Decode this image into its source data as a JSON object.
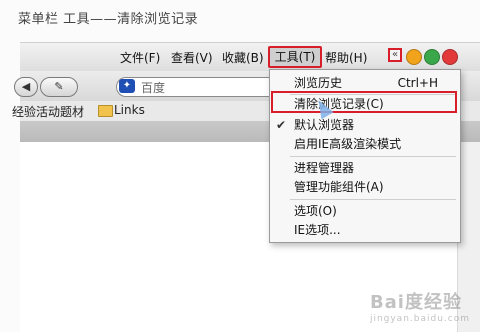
{
  "caption": "菜单栏 工具——清除浏览记录",
  "menubar": {
    "file": "文件(F)",
    "view": "查看(V)",
    "favorites": "收藏(B)",
    "tools": "工具(T)",
    "help": "帮助(H)"
  },
  "navbar": {
    "back_label": "◀",
    "tools_label": "✎",
    "address_placeholder": "百度"
  },
  "favorites_bar": {
    "left_text": "经验活动题材",
    "links": "Links"
  },
  "dropdown": {
    "items": [
      {
        "label": "浏览历史",
        "shortcut": "Ctrl+H"
      },
      {
        "label": "清除浏览记录(C)",
        "shortcut": ""
      },
      {
        "label": "默认浏览器",
        "shortcut": ""
      },
      {
        "label": "启用IE高级渲染模式",
        "shortcut": ""
      },
      {
        "label": "进程管理器",
        "shortcut": ""
      },
      {
        "label": "管理功能组件(A)",
        "shortcut": ""
      },
      {
        "label": "选项(O)",
        "shortcut": ""
      },
      {
        "label": "IE选项...",
        "shortcut": ""
      }
    ],
    "checked_item": "默认浏览器"
  },
  "watermark": {
    "brand": "Bai度经验",
    "sub": "jingyan.baidu.com"
  },
  "colors": {
    "highlight": "#d81e2a",
    "btn_red": "#e23a3a",
    "btn_yellow": "#f1a31c",
    "btn_green": "#3aa84a"
  }
}
